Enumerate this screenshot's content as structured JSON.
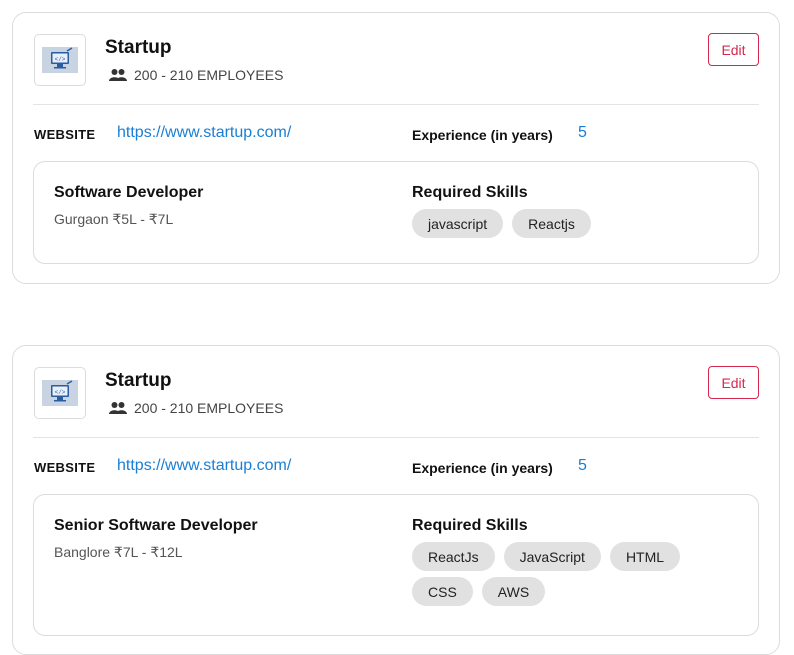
{
  "colors": {
    "accent_link": "#1a7fd4",
    "edit_button": "#d6284f",
    "chip_bg": "#e1e1e1",
    "border": "#dcdcdc"
  },
  "labels": {
    "website": "WEBSITE",
    "experience": "Experience (in years)",
    "required_skills": "Required Skills",
    "edit": "Edit"
  },
  "cards": [
    {
      "company_name": "Startup",
      "logo_icon": "computer-code-icon",
      "employees_icon": "people-icon",
      "employees": "200 - 210 EMPLOYEES",
      "website": "https://www.startup.com/",
      "experience": "5",
      "job": {
        "title": "Software Developer",
        "location_salary": "Gurgaon ₹5L - ₹7L",
        "skills": [
          "javascript",
          "Reactjs"
        ]
      }
    },
    {
      "company_name": "Startup",
      "logo_icon": "computer-code-icon",
      "employees_icon": "people-icon",
      "employees": "200 - 210 EMPLOYEES",
      "website": "https://www.startup.com/",
      "experience": "5",
      "job": {
        "title": "Senior Software Developer",
        "location_salary": "Banglore ₹7L - ₹12L",
        "skills": [
          "ReactJs",
          "JavaScript",
          "HTML",
          "CSS",
          "AWS"
        ]
      }
    }
  ]
}
